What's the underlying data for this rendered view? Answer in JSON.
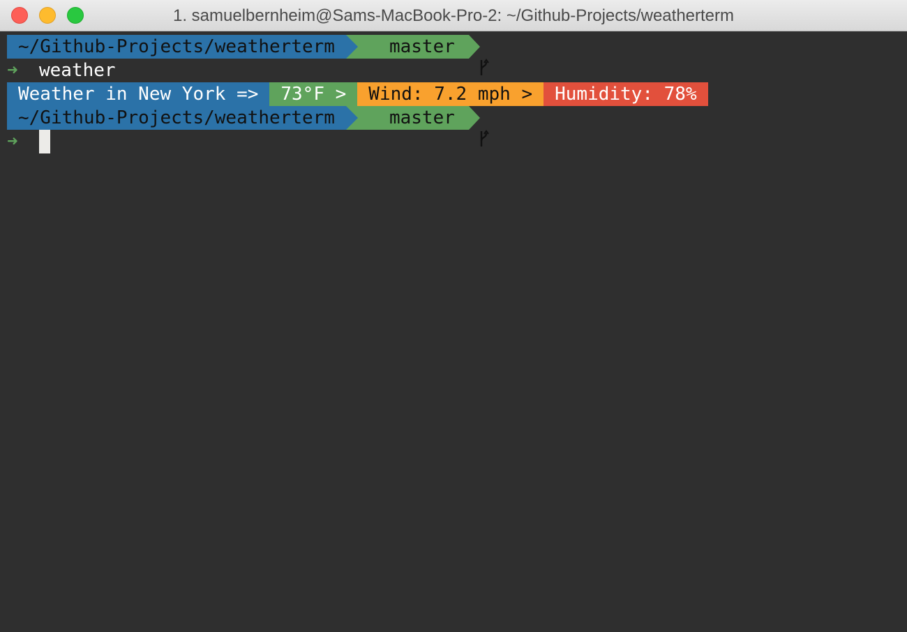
{
  "window": {
    "title": "1. samuelbernheim@Sams-MacBook-Pro-2: ~/Github-Projects/weatherterm"
  },
  "colors": {
    "path_bg": "#2b72a8",
    "git_bg": "#5fa35c",
    "wind_bg": "#f9a12e",
    "humidity_bg": "#e2503c",
    "terminal_bg": "#2f2f2f"
  },
  "terminal": {
    "prompt1": {
      "path": "~/Github-Projects/weatherterm",
      "branch": "master",
      "branch_icon": "git-branch-icon"
    },
    "command": {
      "arrow": "➜",
      "text": "weather"
    },
    "weather_output": {
      "location": "Weather in New York =>",
      "temperature": "73°F >",
      "wind": "Wind: 7.2 mph >",
      "humidity": "Humidity: 78%"
    },
    "prompt2": {
      "path": "~/Github-Projects/weatherterm",
      "branch": "master",
      "branch_icon": "git-branch-icon"
    },
    "input": {
      "arrow": "➜"
    }
  }
}
